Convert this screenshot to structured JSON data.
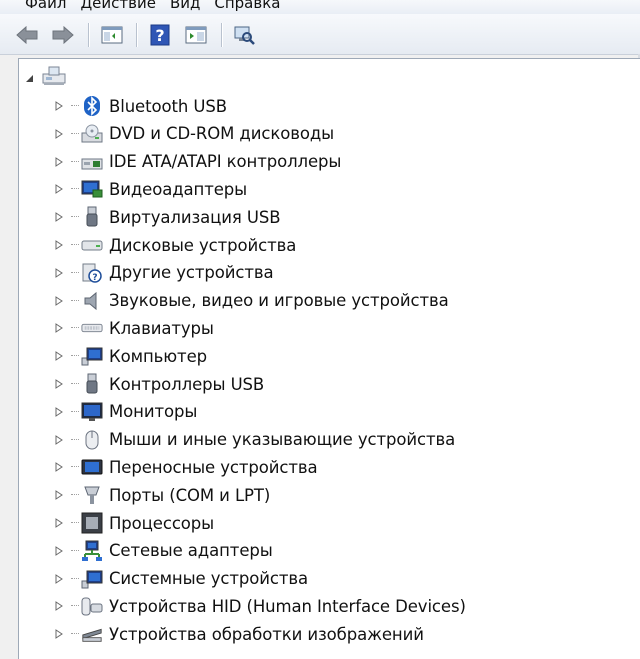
{
  "menu": [
    "Файл",
    "Действие",
    "Вид",
    "Справка"
  ],
  "toolbar": {
    "buttons": [
      "back-icon",
      "forward-icon",
      "show-hide-tree-icon",
      "help-icon",
      "properties-icon",
      "scan-hardware-icon"
    ]
  },
  "tree": {
    "categories": [
      {
        "label": "Bluetooth USB",
        "icon": "bluetooth-icon"
      },
      {
        "label": "DVD и CD-ROM дисководы",
        "icon": "dvd-drive-icon"
      },
      {
        "label": "IDE ATA/ATAPI контроллеры",
        "icon": "ide-controller-icon"
      },
      {
        "label": "Видеоадаптеры",
        "icon": "display-adapter-icon"
      },
      {
        "label": "Виртуализация USB",
        "icon": "usb-virtualization-icon"
      },
      {
        "label": "Дисковые устройства",
        "icon": "disk-drive-icon"
      },
      {
        "label": "Другие устройства",
        "icon": "unknown-device-icon"
      },
      {
        "label": "Звуковые, видео и игровые устройства",
        "icon": "sound-icon"
      },
      {
        "label": "Клавиатуры",
        "icon": "keyboard-icon"
      },
      {
        "label": "Компьютер",
        "icon": "computer-icon"
      },
      {
        "label": "Контроллеры USB",
        "icon": "usb-controller-icon"
      },
      {
        "label": "Мониторы",
        "icon": "monitor-icon"
      },
      {
        "label": "Мыши и иные указывающие устройства",
        "icon": "mouse-icon"
      },
      {
        "label": "Переносные устройства",
        "icon": "portable-device-icon"
      },
      {
        "label": "Порты (COM и LPT)",
        "icon": "port-icon"
      },
      {
        "label": "Процессоры",
        "icon": "processor-icon"
      },
      {
        "label": "Сетевые адаптеры",
        "icon": "network-adapter-icon"
      },
      {
        "label": "Системные устройства",
        "icon": "system-device-icon"
      },
      {
        "label": "Устройства HID (Human Interface Devices)",
        "icon": "hid-icon"
      },
      {
        "label": "Устройства обработки изображений",
        "icon": "imaging-device-icon"
      }
    ]
  }
}
